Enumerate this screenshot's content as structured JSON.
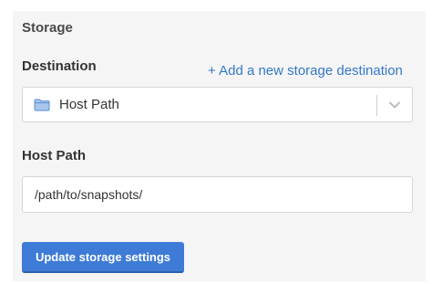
{
  "storage": {
    "section_title": "Storage",
    "destination_label": "Destination",
    "add_destination_link": "+ Add a new storage destination",
    "destination_select": {
      "value": "Host Path",
      "icon": "folder-icon"
    },
    "host_path_label": "Host Path",
    "host_path_input": {
      "value": "/path/to/snapshots/",
      "placeholder": ""
    },
    "update_button": "Update storage settings"
  },
  "colors": {
    "accent": "#3e7bd6",
    "link": "#3478c8",
    "panel_bg": "#f5f5f5"
  }
}
